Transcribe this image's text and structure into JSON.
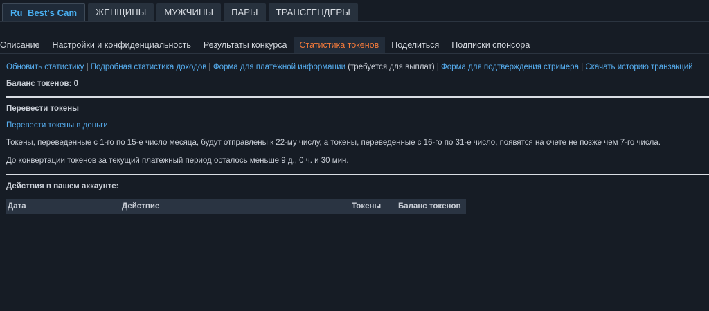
{
  "top_tabs": [
    {
      "label": "Ru_Best's Cam",
      "active": true
    },
    {
      "label": "ЖЕНЩИНЫ"
    },
    {
      "label": "МУЖЧИНЫ"
    },
    {
      "label": "ПАРЫ"
    },
    {
      "label": "ТРАНСГЕНДЕРЫ"
    }
  ],
  "sub_tabs": [
    {
      "label": "Описание"
    },
    {
      "label": "Настройки и конфиденциальность"
    },
    {
      "label": "Результаты конкурса"
    },
    {
      "label": "Статистика токенов",
      "active": true
    },
    {
      "label": "Поделиться"
    },
    {
      "label": "Подписки спонсора"
    }
  ],
  "links": {
    "refresh": "Обновить статистику",
    "income": "Подробная статистика доходов",
    "payment_form": "Форма для платежной информации",
    "payment_note": " (требуется для выплат) ",
    "streamer_form": "Форма для подтверждения стримера",
    "download": "Скачать историю транзакций",
    "separator": "|"
  },
  "balance": {
    "label": "Баланс токенов: ",
    "value": "0"
  },
  "convert": {
    "title": "Перевести токены",
    "link": "Перевести токены в деньги",
    "info": "Токены, переведенные с 1-го по 15-е число месяца, будут отправлены к 22-му числу, а токены, переведенные с 16-го по 31-е число, появятся на счете не позже чем 7-го числа.",
    "remaining": "До конвертации токенов за текущий платежный период осталось меньше 9 д., 0 ч. и 30 мин."
  },
  "activity": {
    "title": "Действия в вашем аккаунте:",
    "columns": {
      "date": "Дата",
      "action": "Действие",
      "tokens": "Токены",
      "balance": "Баланс токенов"
    }
  },
  "colors": {
    "background": "#161c25",
    "link": "#56aef0",
    "active_subtab": "#f47a3a",
    "active_tab": "#4ab2f5"
  }
}
